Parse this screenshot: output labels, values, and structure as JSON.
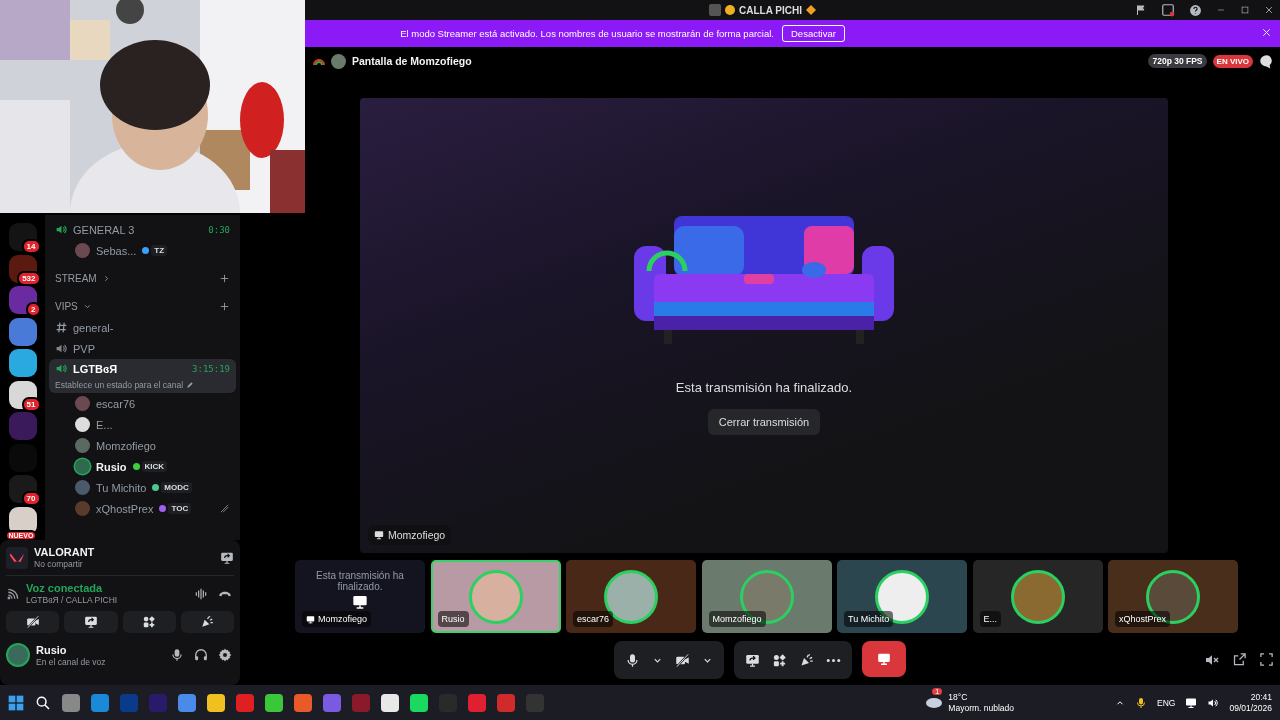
{
  "window": {
    "title": "CALLA PICHI"
  },
  "streamer_banner": {
    "text": "El modo Streamer está activado. Los nombres de usuario se mostrarán de forma parcial.",
    "button": "Desactivar"
  },
  "stream_header": {
    "title": "Pantalla de Momzofiego",
    "quality": "720p 30 FPS",
    "live": "EN VIVO"
  },
  "stage": {
    "message": "Esta transmisión ha finalizado.",
    "button": "Cerrar transmisión",
    "label": "Momzofiego"
  },
  "servers": [
    {
      "badge": "14",
      "color": "#141414"
    },
    {
      "badge": "532",
      "color": "#5a1a10"
    },
    {
      "badge": "2",
      "color": "#6a2aa0"
    },
    {
      "color": "#4a7ad8"
    },
    {
      "color": "#2aa8e0"
    },
    {
      "badge": "51",
      "color": "#d8d8d8"
    },
    {
      "color": "#3a1a5a"
    },
    {
      "color": "#0a0a0a"
    },
    {
      "badge": "70",
      "color": "#1a1a1a"
    },
    {
      "badge": "NUEVO",
      "color": "#d8d0c8"
    }
  ],
  "channels": [
    {
      "kind": "voice",
      "name": "GENERAL 3",
      "timer": "0:30",
      "selected": false,
      "members": [
        {
          "name": "Sebas...",
          "speaking": false,
          "muted": false,
          "tag": {
            "label": "TZ",
            "color": "#3aa0ff"
          }
        }
      ]
    },
    {
      "kind": "category",
      "name": "STREAM",
      "expanded": false
    },
    {
      "kind": "category",
      "name": "VIPS",
      "expanded": true
    },
    {
      "kind": "text",
      "name": "general-",
      "selected": false
    },
    {
      "kind": "voice",
      "name": "PVP",
      "selected": false
    },
    {
      "kind": "voice",
      "name": "LGTBɞЯ",
      "timer": "3:15:19",
      "status": "Establece un estado para el canal",
      "selected": true,
      "members": [
        {
          "name": "escar76",
          "speaking": false,
          "muted": false
        },
        {
          "name": "E...",
          "speaking": false,
          "muted": false
        },
        {
          "name": "Momzofiego",
          "speaking": false,
          "muted": false
        },
        {
          "name": "Rusio",
          "speaking": true,
          "muted": false,
          "tag": {
            "label": "KICK",
            "color": "#3ad23a"
          }
        },
        {
          "name": "Tu Michito",
          "speaking": false,
          "muted": false,
          "tag": {
            "label": "MODC",
            "color": "#4ac890"
          }
        },
        {
          "name": "xQhostPrex",
          "speaking": false,
          "muted": true,
          "tag": {
            "label": "TOC",
            "color": "#a060f0"
          }
        }
      ]
    }
  ],
  "activity": {
    "game": "VALORANT",
    "status": "No compartir"
  },
  "voice": {
    "status": "Voz conectada",
    "channel": "LGTBɞЯ / CALLA PICHI"
  },
  "user": {
    "name": "Rusio",
    "status": "En el canal de voz"
  },
  "participants": [
    {
      "kind": "stream",
      "name": "Momzofiego",
      "message": "Esta transmisión ha finalizado.",
      "selected": false,
      "color": "#141420"
    },
    {
      "kind": "user",
      "name": "Rusio",
      "selected": true,
      "color": "#b89aa4"
    },
    {
      "kind": "user",
      "name": "escar76",
      "selected": false,
      "color": "#4a2818"
    },
    {
      "kind": "user",
      "name": "Momzofiego",
      "selected": false,
      "color": "#6a7a6c"
    },
    {
      "kind": "user",
      "name": "Tu Michito",
      "selected": false,
      "color": "#2c4650"
    },
    {
      "kind": "user",
      "name": "E...",
      "selected": false,
      "color": "#262626"
    },
    {
      "kind": "user",
      "name": "xQhostPrex",
      "selected": false,
      "color": "#4a2e1c"
    }
  ],
  "taskbar": {
    "weather": {
      "badge": "1",
      "temp": "18°C",
      "text": "Mayorm. nublado"
    },
    "language": "ENG",
    "time": "20:41",
    "date": "09/01/2026"
  }
}
